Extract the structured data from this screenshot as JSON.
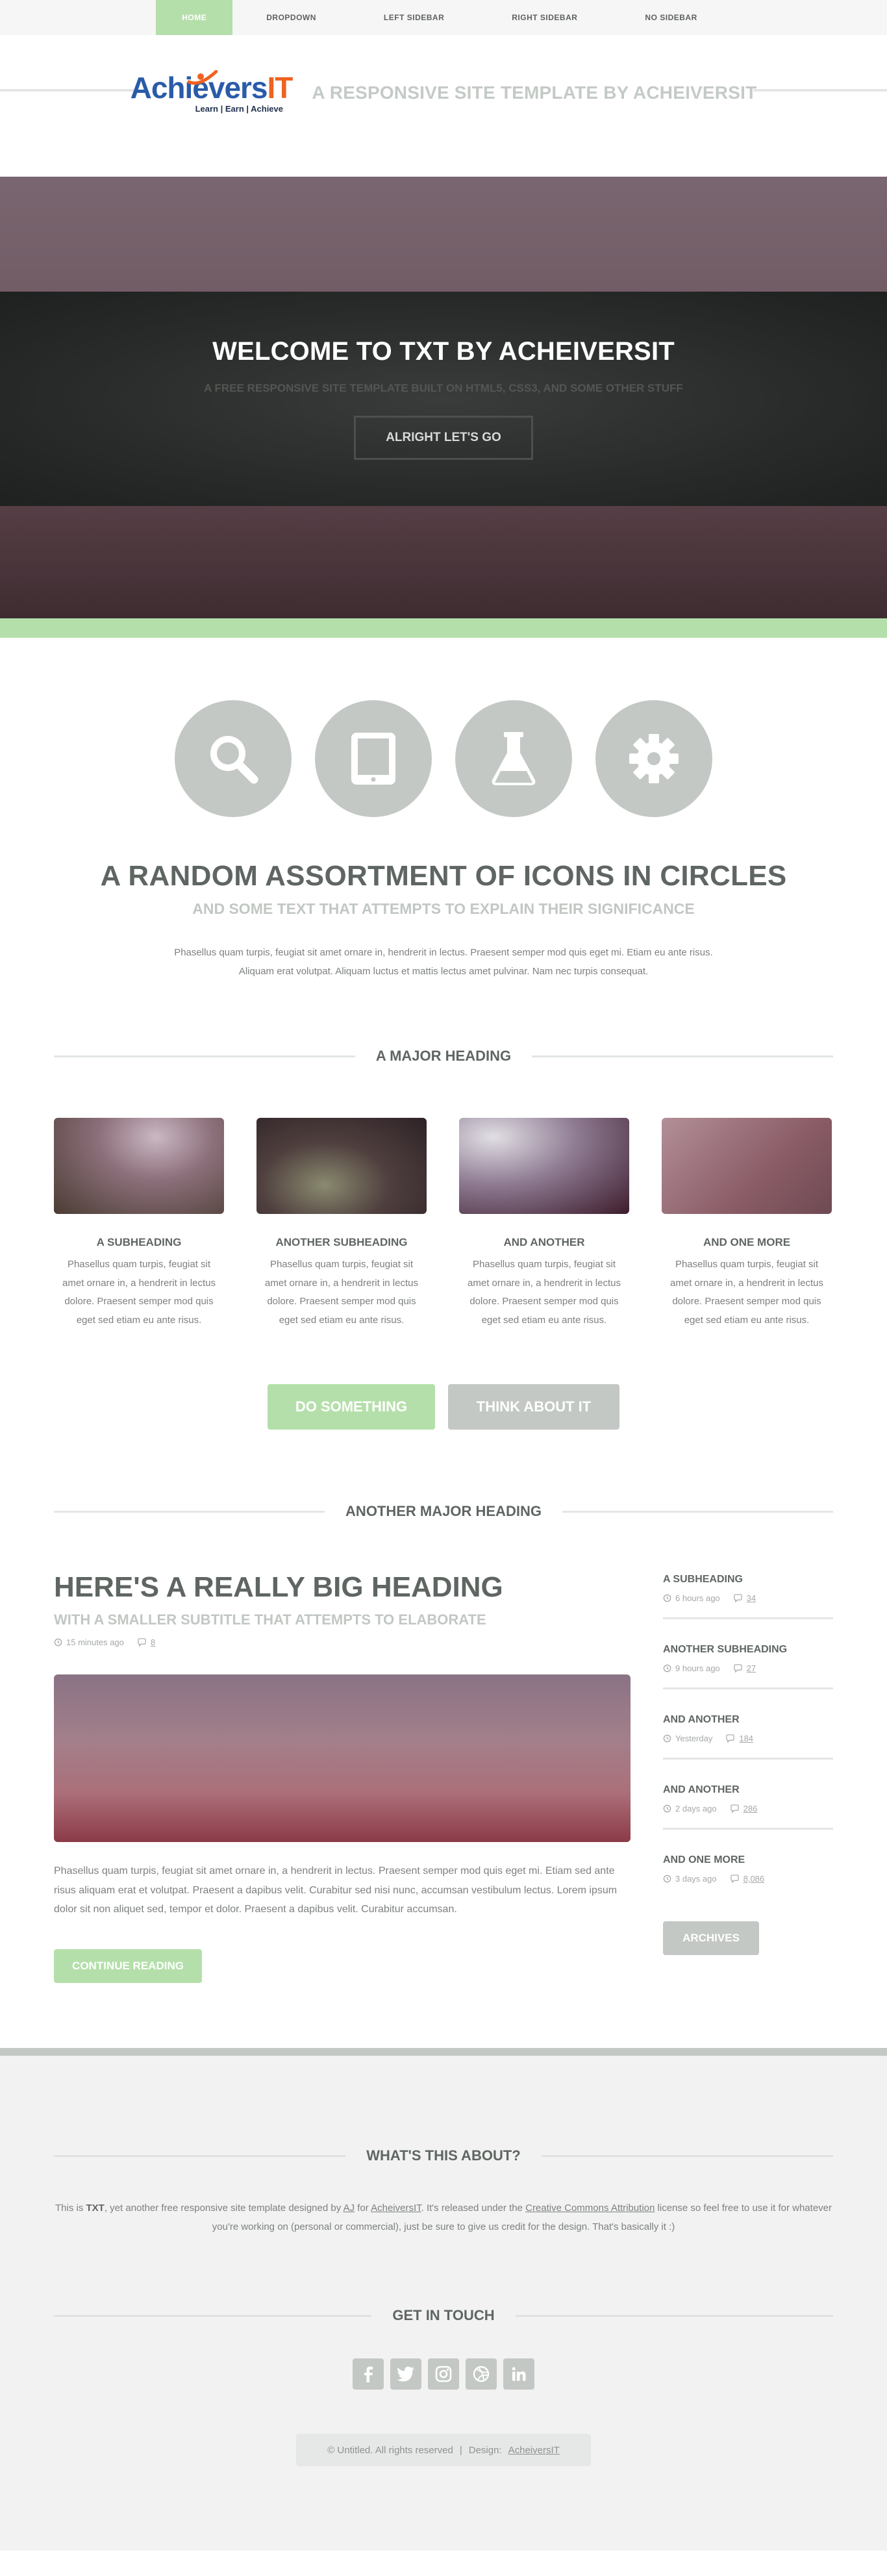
{
  "nav": {
    "items": [
      {
        "label": "HOME",
        "active": true
      },
      {
        "label": "DROPDOWN"
      },
      {
        "label": "LEFT SIDEBAR"
      },
      {
        "label": "RIGHT SIDEBAR"
      },
      {
        "label": "NO SIDEBAR"
      }
    ]
  },
  "header": {
    "logo_part1": "Achie",
    "logo_part2": "vers",
    "logo_part3": "IT",
    "logo_tagline": "Learn | Earn | Achieve",
    "tagline": "A RESPONSIVE SITE TEMPLATE BY ACHEIVERSIT"
  },
  "hero": {
    "title": "WELCOME TO TXT BY ACHEIVERSIT",
    "subtitle": "A FREE RESPONSIVE SITE TEMPLATE BUILT ON HTML5, CSS3, AND SOME OTHER STUFF",
    "button": "ALRIGHT LET'S GO"
  },
  "icons": {
    "items": [
      "search-icon",
      "tablet-icon",
      "flask-icon",
      "gear-icon"
    ],
    "title": "A RANDOM ASSORTMENT OF ICONS IN CIRCLES",
    "subtitle": "AND SOME TEXT THAT ATTEMPTS TO EXPLAIN THEIR SIGNIFICANCE",
    "text": "Phasellus quam turpis, feugiat sit amet ornare in, hendrerit in lectus. Praesent semper mod quis eget mi. Etiam eu ante risus. Aliquam erat volutpat. Aliquam luctus et mattis lectus amet pulvinar. Nam nec turpis consequat."
  },
  "major": {
    "heading": "A MAJOR HEADING",
    "features": [
      {
        "title": "A SUBHEADING",
        "text": "Phasellus quam turpis, feugiat sit amet ornare in, a hendrerit in lectus dolore. Praesent semper mod quis eget sed etiam eu ante risus."
      },
      {
        "title": "ANOTHER SUBHEADING",
        "text": "Phasellus quam turpis, feugiat sit amet ornare in, a hendrerit in lectus dolore. Praesent semper mod quis eget sed etiam eu ante risus."
      },
      {
        "title": "AND ANOTHER",
        "text": "Phasellus quam turpis, feugiat sit amet ornare in, a hendrerit in lectus dolore. Praesent semper mod quis eget sed etiam eu ante risus."
      },
      {
        "title": "AND ONE MORE",
        "text": "Phasellus quam turpis, feugiat sit amet ornare in, a hendrerit in lectus dolore. Praesent semper mod quis eget sed etiam eu ante risus."
      }
    ],
    "button_primary": "DO SOMETHING",
    "button_secondary": "THINK ABOUT IT"
  },
  "another": {
    "heading": "ANOTHER MAJOR HEADING",
    "post": {
      "title": "HERE'S A REALLY BIG HEADING",
      "subtitle": "WITH A SMALLER SUBTITLE THAT ATTEMPTS TO ELABORATE",
      "time": "15 minutes ago",
      "comments": "8",
      "text": "Phasellus quam turpis, feugiat sit amet ornare in, a hendrerit in lectus. Praesent semper mod quis eget mi. Etiam sed ante risus aliquam erat et volutpat. Praesent a dapibus velit. Curabitur sed nisi nunc, accumsan vestibulum lectus. Lorem ipsum dolor sit non aliquet sed, tempor et dolor. Praesent a dapibus velit. Curabitur accumsan.",
      "button": "CONTINUE READING"
    },
    "sidebar": [
      {
        "title": "A SUBHEADING",
        "time": "6 hours ago",
        "comments": "34"
      },
      {
        "title": "ANOTHER SUBHEADING",
        "time": "9 hours ago",
        "comments": "27"
      },
      {
        "title": "AND ANOTHER",
        "time": "Yesterday",
        "comments": "184"
      },
      {
        "title": "AND ANOTHER",
        "time": "2 days ago",
        "comments": "286"
      },
      {
        "title": "AND ONE MORE",
        "time": "3 days ago",
        "comments": "8,086"
      }
    ],
    "archives_button": "ARCHIVES"
  },
  "footer": {
    "about_heading": "WHAT'S THIS ABOUT?",
    "about_prefix": "This is ",
    "about_bold": "TXT",
    "about_mid1": ", yet another free responsive site template designed by ",
    "about_link1": "AJ",
    "about_mid2": " for ",
    "about_link2": "AcheiversIT",
    "about_mid3": ". It's released under the ",
    "about_link3": "Creative Commons Attribution",
    "about_suffix": " license so feel free to use it for whatever you're working on (personal or commercial), just be sure to give us credit for the design. That's basically it :)",
    "touch_heading": "GET IN TOUCH",
    "socials": [
      "facebook-icon",
      "twitter-icon",
      "instagram-icon",
      "dribbble-icon",
      "linkedin-icon"
    ],
    "copyright": "© Untitled. All rights reserved",
    "separator": "|",
    "design_label": "Design:",
    "design_link": "AcheiversIT"
  },
  "colors": {
    "accent_green": "#b5dfaa",
    "accent_gray": "#c3c8c4",
    "heading": "#5f6662",
    "logo_blue": "#2a5ba9",
    "logo_orange": "#ef6220"
  }
}
